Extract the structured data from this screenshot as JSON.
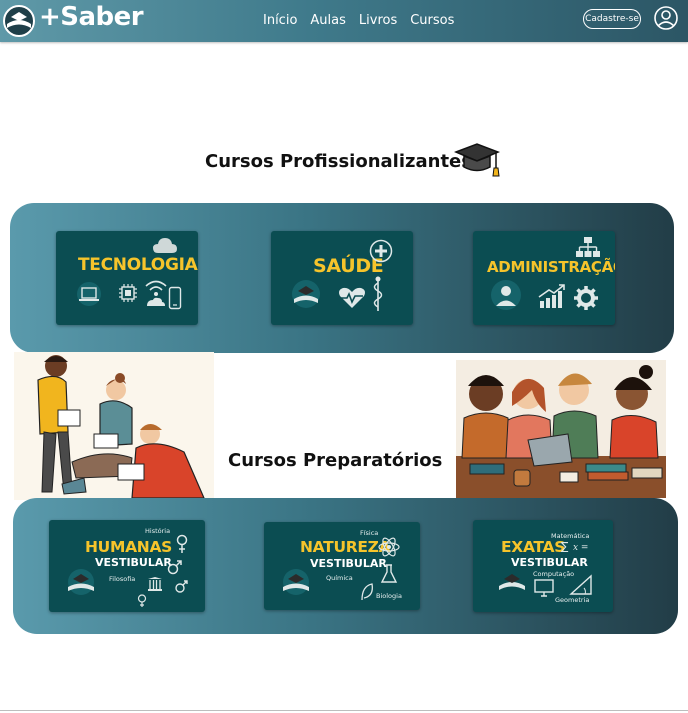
{
  "header": {
    "brand": "+Saber",
    "nav": [
      "Início",
      "Aulas",
      "Livros",
      "Cursos"
    ],
    "signup_label": "Cadastre-se"
  },
  "professional": {
    "title": "Cursos Profissionalizantes",
    "cards": [
      {
        "title": "TECNOLOGIA"
      },
      {
        "title": "SAÚDE"
      },
      {
        "title": "ADMINISTRAÇÃO"
      }
    ]
  },
  "preparatory": {
    "title": "Cursos Preparatórios",
    "cards": [
      {
        "title": "HUMANAS",
        "sub": "VESTIBULAR",
        "tags": [
          "História",
          "Filosofia"
        ]
      },
      {
        "title": "NATUREZA",
        "sub": "VESTIBULAR",
        "tags": [
          "Física",
          "Química",
          "Biologia"
        ]
      },
      {
        "title": "EXATAS",
        "sub": "VESTIBULAR",
        "tags": [
          "Matemática",
          "Computação",
          "Geometria"
        ]
      }
    ]
  },
  "colors": {
    "header_start": "#5f99a8",
    "header_end": "#2c5665",
    "card_bg": "#0b4d52",
    "card_title": "#f6c42b"
  },
  "icons": [
    "logo-icon",
    "user-icon",
    "graduation-cap-icon",
    "laptop-icon",
    "chip-icon",
    "wifi-icon",
    "phone-icon",
    "cloud-icon",
    "book-icon",
    "heart-pulse-icon",
    "caduceus-icon",
    "plus-icon",
    "person-icon",
    "chart-icon",
    "gear-icon",
    "org-chart-icon"
  ]
}
